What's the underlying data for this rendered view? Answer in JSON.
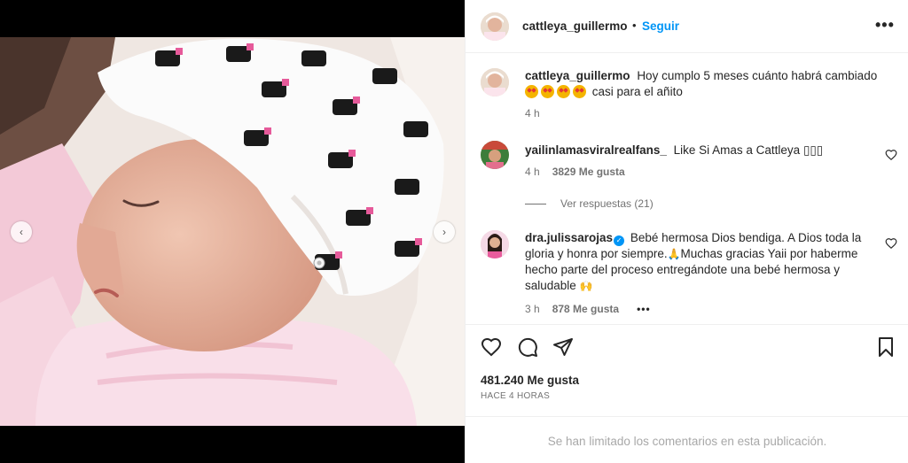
{
  "post": {
    "username": "cattleya_guillermo",
    "follow_label": "Seguir",
    "header_separator": "•",
    "more_label": "•••"
  },
  "media": {
    "prev_label": "‹",
    "next_label": "›"
  },
  "caption": {
    "username": "cattleya_guillermo",
    "text": "Hoy cumplo 5 meses cuánto habrá cambiado",
    "text_after_emoji": "casi para el añito",
    "emoji_count": 4,
    "time": "4 h"
  },
  "comments": [
    {
      "username": "yailinlamasviralrealfans_",
      "text": "Like Si Amas a Cattleya ▯▯▯",
      "time": "4 h",
      "likes": "3829 Me gusta",
      "view_replies": "Ver respuestas (21)"
    },
    {
      "username": "dra.julissarojas",
      "verified": true,
      "text_part1": "Bebé hermosa Dios bendiga. A Dios toda la gloria y honra por siempre.",
      "text_part2": "Muchas gracias Yaii por haberme hecho parte del proceso entregándote una bebé hermosa y saludable",
      "time": "3 h",
      "likes": "878 Me gusta",
      "more_label": "•••"
    }
  ],
  "actions": {
    "likes": "481.240 Me gusta",
    "time_ago": "HACE 4 HORAS"
  },
  "footer": {
    "message": "Se han limitado los comentarios en esta publicación."
  },
  "colors": {
    "accent": "#0095f6",
    "text": "#262626",
    "secondary": "#737373",
    "muted": "#a8a8a8"
  }
}
